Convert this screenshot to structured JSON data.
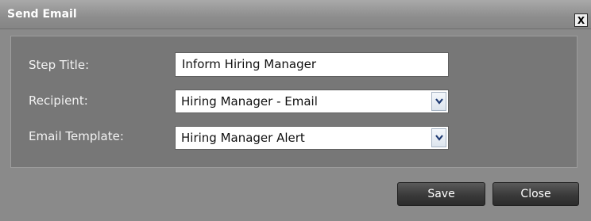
{
  "dialog": {
    "title": "Send Email",
    "close_glyph": "X"
  },
  "form": {
    "step_title_label": "Step Title:",
    "step_title_value": "Inform Hiring Manager",
    "recipient_label": "Recipient:",
    "recipient_value": "Hiring Manager - Email",
    "email_template_label": "Email Template:",
    "email_template_value": "Hiring Manager Alert"
  },
  "buttons": {
    "save": "Save",
    "close": "Close"
  },
  "icons": {
    "close": "close-icon",
    "dropdown": "chevron-down-icon"
  },
  "colors": {
    "dialog_bg": "#8a8a8a",
    "panel_bg": "#777777",
    "button_bg": "#3a3a3a",
    "dropdown_arrow": "#1f3b73"
  }
}
